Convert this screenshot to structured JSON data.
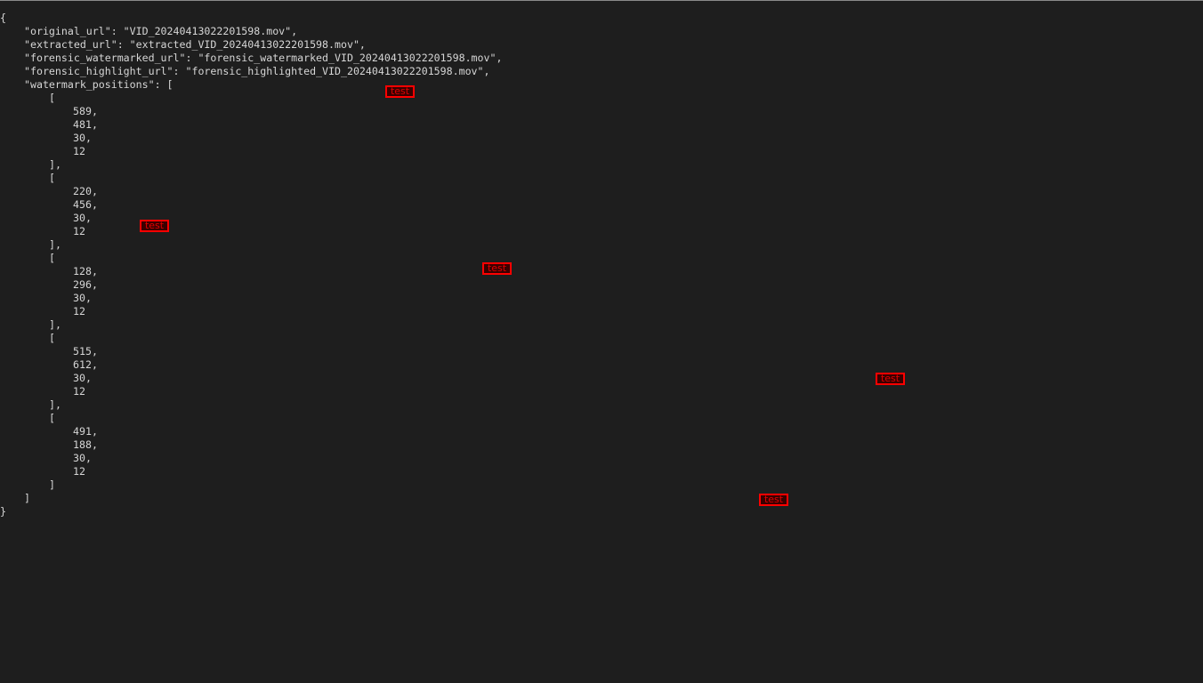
{
  "json_lines": [
    {
      "indent": 0,
      "text": "{"
    },
    {
      "indent": 1,
      "text": "\"original_url\": \"VID_20240413022201598.mov\","
    },
    {
      "indent": 1,
      "text": "\"extracted_url\": \"extracted_VID_20240413022201598.mov\","
    },
    {
      "indent": 1,
      "text": "\"forensic_watermarked_url\": \"forensic_watermarked_VID_20240413022201598.mov\","
    },
    {
      "indent": 1,
      "text": "\"forensic_highlight_url\": \"forensic_highlighted_VID_20240413022201598.mov\","
    },
    {
      "indent": 1,
      "text": "\"watermark_positions\": ["
    },
    {
      "indent": 2,
      "text": "["
    },
    {
      "indent": 3,
      "text": "589,"
    },
    {
      "indent": 3,
      "text": "481,"
    },
    {
      "indent": 3,
      "text": "30,"
    },
    {
      "indent": 3,
      "text": "12"
    },
    {
      "indent": 2,
      "text": "],"
    },
    {
      "indent": 2,
      "text": "["
    },
    {
      "indent": 3,
      "text": "220,"
    },
    {
      "indent": 3,
      "text": "456,"
    },
    {
      "indent": 3,
      "text": "30,"
    },
    {
      "indent": 3,
      "text": "12"
    },
    {
      "indent": 2,
      "text": "],"
    },
    {
      "indent": 2,
      "text": "["
    },
    {
      "indent": 3,
      "text": "128,"
    },
    {
      "indent": 3,
      "text": "296,"
    },
    {
      "indent": 3,
      "text": "30,"
    },
    {
      "indent": 3,
      "text": "12"
    },
    {
      "indent": 2,
      "text": "],"
    },
    {
      "indent": 2,
      "text": "["
    },
    {
      "indent": 3,
      "text": "515,"
    },
    {
      "indent": 3,
      "text": "612,"
    },
    {
      "indent": 3,
      "text": "30,"
    },
    {
      "indent": 3,
      "text": "12"
    },
    {
      "indent": 2,
      "text": "],"
    },
    {
      "indent": 2,
      "text": "["
    },
    {
      "indent": 3,
      "text": "491,"
    },
    {
      "indent": 3,
      "text": "188,"
    },
    {
      "indent": 3,
      "text": "30,"
    },
    {
      "indent": 3,
      "text": "12"
    },
    {
      "indent": 2,
      "text": "]"
    },
    {
      "indent": 1,
      "text": "]"
    },
    {
      "indent": 0,
      "text": "}"
    }
  ],
  "watermarks": [
    {
      "label": "test"
    },
    {
      "label": "test"
    },
    {
      "label": "test"
    },
    {
      "label": "test"
    },
    {
      "label": "test"
    }
  ],
  "colors": {
    "background": "#1e1e1e",
    "text": "#d6d6d6",
    "watermark": "#ff0000"
  }
}
